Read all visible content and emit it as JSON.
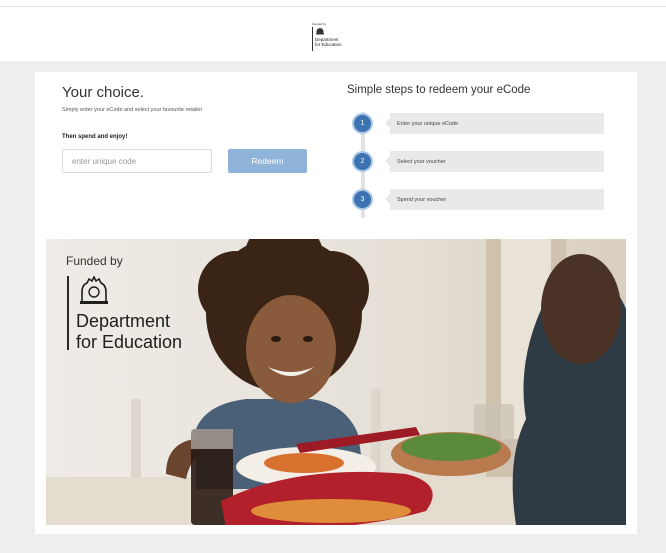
{
  "header": {
    "logo": {
      "funded_by": "Funded by",
      "department": [
        "Department",
        "for Education"
      ],
      "icon": "royal-crest-icon"
    }
  },
  "choice": {
    "title": "Your choice.",
    "subtitle": "Simply enter your eCode and select your favourite retailer",
    "spend_text": "Then spend and enjoy!",
    "code_placeholder": "enter unique code",
    "code_value": "",
    "redeem_label": "Redeem"
  },
  "steps": {
    "title": "Simple steps to redeem your eCode",
    "items": [
      {
        "number": "1",
        "label": "Enter your unique eCode"
      },
      {
        "number": "2",
        "label": "Select your voucher"
      },
      {
        "number": "3",
        "label": "Spend your voucher"
      }
    ]
  },
  "hero": {
    "funded_by": "Funded by",
    "department": [
      "Department",
      "for Education"
    ],
    "icon": "royal-crest-icon",
    "photo": "family-meal-photo"
  },
  "colors": {
    "accent": "#3c73b0",
    "button": "#8fb3d9",
    "band": "#eeeeee",
    "step_box": "#e9e9e9"
  }
}
